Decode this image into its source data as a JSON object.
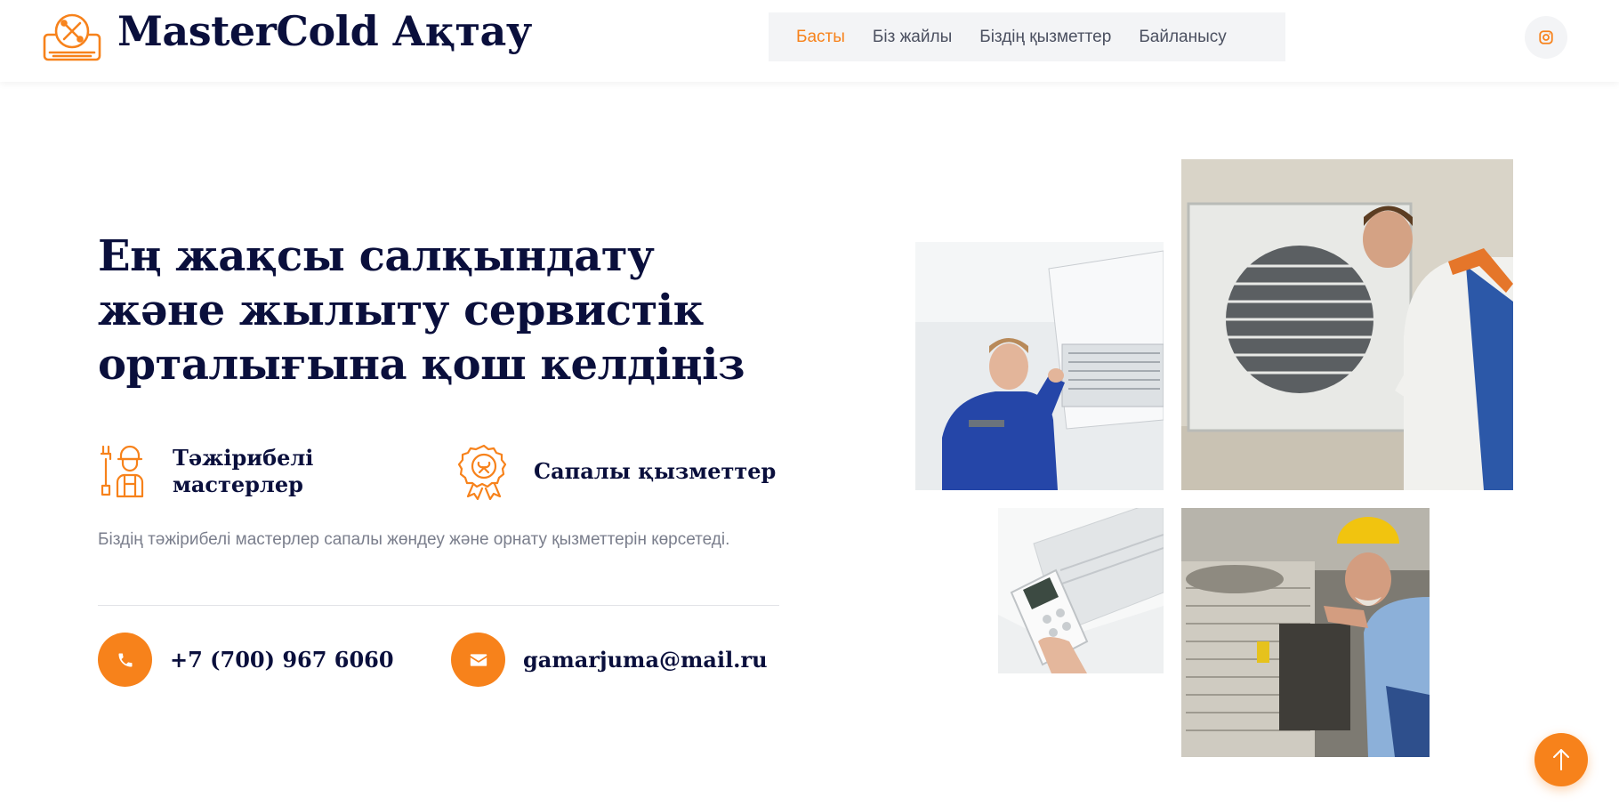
{
  "brand": {
    "name": "MasterCold Ақтау",
    "logo_icon": "ac-repair-icon",
    "accent": "#f7821b",
    "dark": "#0a0f3c"
  },
  "nav": {
    "items": [
      {
        "label": "Басты",
        "active": true
      },
      {
        "label": "Біз жайлы",
        "active": false
      },
      {
        "label": "Біздің қызметтер",
        "active": false
      },
      {
        "label": "Байланысу",
        "active": false
      }
    ],
    "social_icon": "instagram-icon"
  },
  "hero": {
    "title": "Ең жақсы салқындату және жылыту сервистік орталығына қош келдіңіз",
    "features": [
      {
        "icon": "technician-icon",
        "label": "Тәжірибелі мастерлер"
      },
      {
        "icon": "quality-badge-icon",
        "label": "Сапалы қызметтер"
      }
    ],
    "description": "Біздің тәжірибелі мастерлер сапалы жөндеу және орнату қызметтерін көрсетеді.",
    "contacts": {
      "phone": {
        "icon": "phone-icon",
        "value": "+7 (700) 967 6060"
      },
      "email": {
        "icon": "envelope-icon",
        "value": "gamarjuma@mail.ru"
      }
    }
  },
  "scroll_top_icon": "arrow-up-icon"
}
